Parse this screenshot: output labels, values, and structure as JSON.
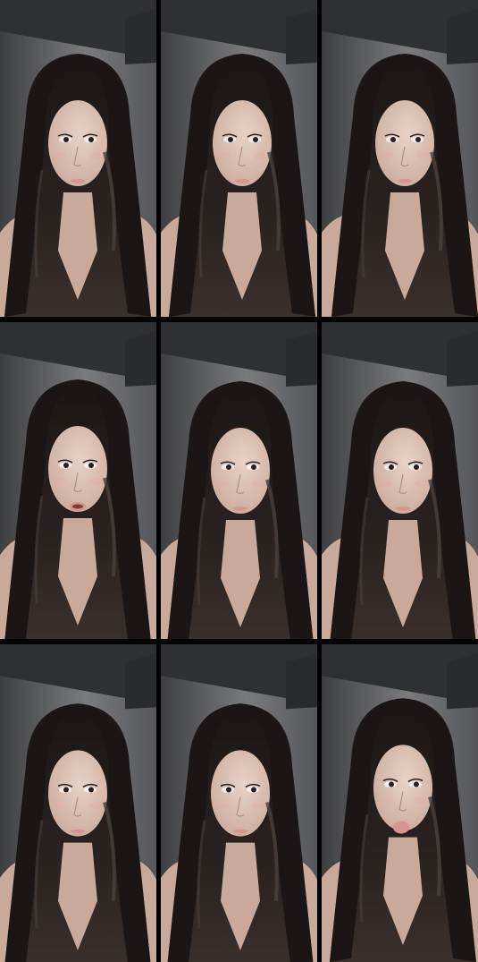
{
  "grid": {
    "rows": 3,
    "columns": 3
  },
  "frames": [
    {
      "id": 1,
      "mouth": "closed"
    },
    {
      "id": 2,
      "mouth": "closed"
    },
    {
      "id": 3,
      "mouth": "closed"
    },
    {
      "id": 4,
      "mouth": "open"
    },
    {
      "id": 5,
      "mouth": "closed"
    },
    {
      "id": 6,
      "mouth": "closed"
    },
    {
      "id": 7,
      "mouth": "closed"
    },
    {
      "id": 8,
      "mouth": "closed"
    },
    {
      "id": 9,
      "mouth": "pout"
    }
  ],
  "colors": {
    "wall": "#6c6d6f",
    "ceiling": "#2f3032",
    "hair": "#1b1615",
    "hair_highlight": "#4a403d",
    "skin": "#e8d2c6",
    "skin_shadow": "#c9a999",
    "lips": "#d89490",
    "eyes": "#2a1f1c"
  }
}
